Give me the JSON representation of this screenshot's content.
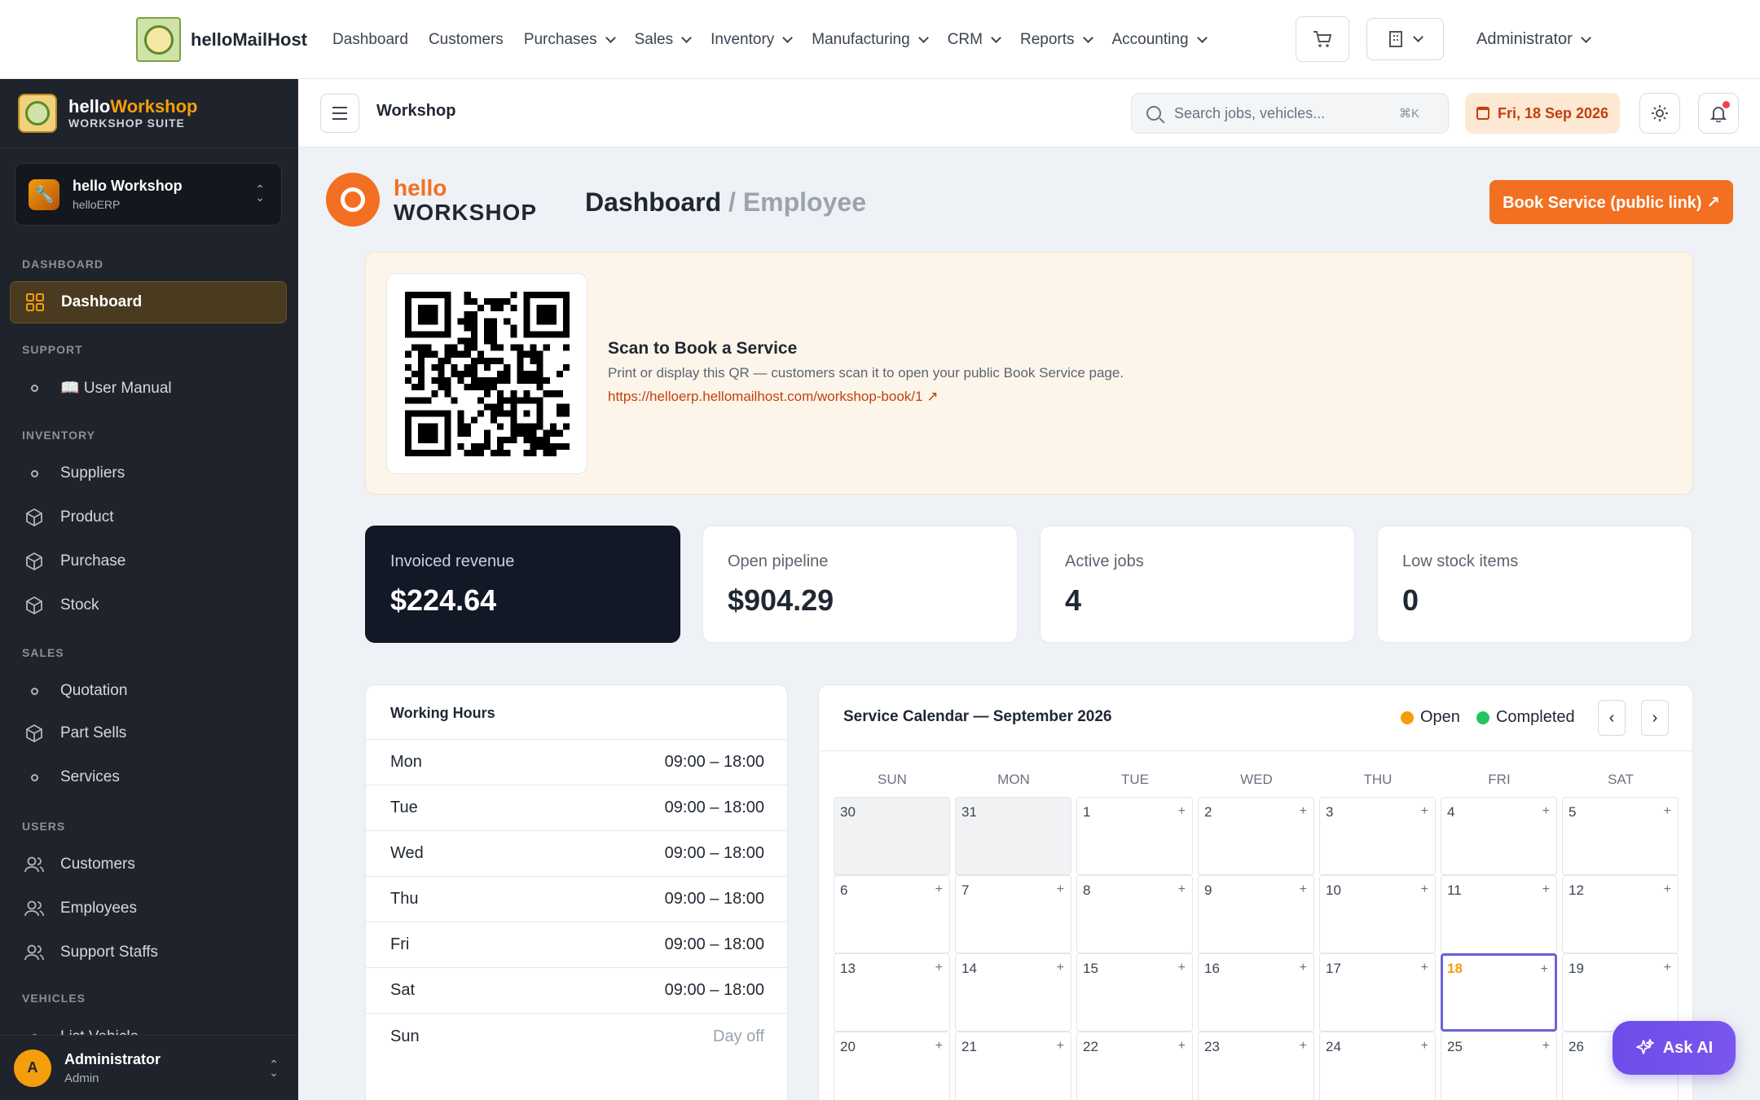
{
  "topnav": {
    "brand": "helloMailHost",
    "menu": [
      {
        "label": "Dashboard",
        "dropdown": false
      },
      {
        "label": "Customers",
        "dropdown": false
      },
      {
        "label": "Purchases",
        "dropdown": true
      },
      {
        "label": "Sales",
        "dropdown": true
      },
      {
        "label": "Inventory",
        "dropdown": true
      },
      {
        "label": "Manufacturing",
        "dropdown": true
      },
      {
        "label": "CRM",
        "dropdown": true
      },
      {
        "label": "Reports",
        "dropdown": true
      },
      {
        "label": "Accounting",
        "dropdown": true
      }
    ],
    "user": "Administrator",
    "icons": {
      "cart": "cart-icon",
      "building": "building-icon"
    }
  },
  "sidebar": {
    "brand_main": "hello",
    "brand_accent": "Workshop",
    "brand_sub": "WORKSHOP SUITE",
    "workspace": {
      "name": "hello Workshop",
      "sub": "helloERP"
    },
    "sections": {
      "dashboard": "DASHBOARD",
      "support": "SUPPORT",
      "inventory": "INVENTORY",
      "sales": "SALES",
      "users": "USERS",
      "vehicles": "VEHICLES"
    },
    "items": {
      "dashboard": "Dashboard",
      "user_manual": "📖 User Manual",
      "suppliers": "Suppliers",
      "product": "Product",
      "purchase": "Purchase",
      "stock": "Stock",
      "quotation": "Quotation",
      "part_sells": "Part Sells",
      "services": "Services",
      "customers": "Customers",
      "employees": "Employees",
      "support_staffs": "Support Staffs",
      "list_vehicle": "List Vehicle"
    },
    "footer": {
      "initial": "A",
      "name": "Administrator",
      "role": "Admin"
    }
  },
  "subheader": {
    "title": "Workshop",
    "search_placeholder": "Search jobs, vehicles...",
    "search_shortcut": "⌘K",
    "date": "Fri, 18 Sep 2026"
  },
  "page": {
    "logo_hello": "hello",
    "logo_workshop": "WORKSHOP",
    "crumb_main": "Dashboard",
    "crumb_sep": "/",
    "crumb_tail": "Employee",
    "book_button": "Book Service (public link) ↗"
  },
  "qr": {
    "title": "Scan to Book a Service",
    "description": "Print or display this QR — customers scan it to open your public Book Service page.",
    "link": "https://helloerp.hellomailhost.com/workshop-book/1 ↗"
  },
  "stats": [
    {
      "label": "Invoiced revenue",
      "value": "$224.64"
    },
    {
      "label": "Open pipeline",
      "value": "$904.29"
    },
    {
      "label": "Active jobs",
      "value": "4"
    },
    {
      "label": "Low stock items",
      "value": "0"
    }
  ],
  "hours": {
    "title": "Working Hours",
    "rows": [
      {
        "day": "Mon",
        "time": "09:00 – 18:00"
      },
      {
        "day": "Tue",
        "time": "09:00 – 18:00"
      },
      {
        "day": "Wed",
        "time": "09:00 – 18:00"
      },
      {
        "day": "Thu",
        "time": "09:00 – 18:00"
      },
      {
        "day": "Fri",
        "time": "09:00 – 18:00"
      },
      {
        "day": "Sat",
        "time": "09:00 – 18:00"
      },
      {
        "day": "Sun",
        "time": "Day off"
      }
    ]
  },
  "calendar": {
    "title": "Service Calendar — September 2026",
    "legend": [
      {
        "label": "Open",
        "color": "#f59e0b"
      },
      {
        "label": "Completed",
        "color": "#22c55e"
      }
    ],
    "prev": "‹",
    "next": "›",
    "weekdays": [
      "SUN",
      "MON",
      "TUE",
      "WED",
      "THU",
      "FRI",
      "SAT"
    ],
    "today": "18",
    "weeks": [
      [
        "30",
        "31",
        "1",
        "2",
        "3",
        "4",
        "5"
      ],
      [
        "6",
        "7",
        "8",
        "9",
        "10",
        "11",
        "12"
      ],
      [
        "13",
        "14",
        "15",
        "16",
        "17",
        "18",
        "19"
      ],
      [
        "20",
        "21",
        "22",
        "23",
        "24",
        "25",
        "26"
      ]
    ]
  },
  "ask_ai": "Ask AI"
}
